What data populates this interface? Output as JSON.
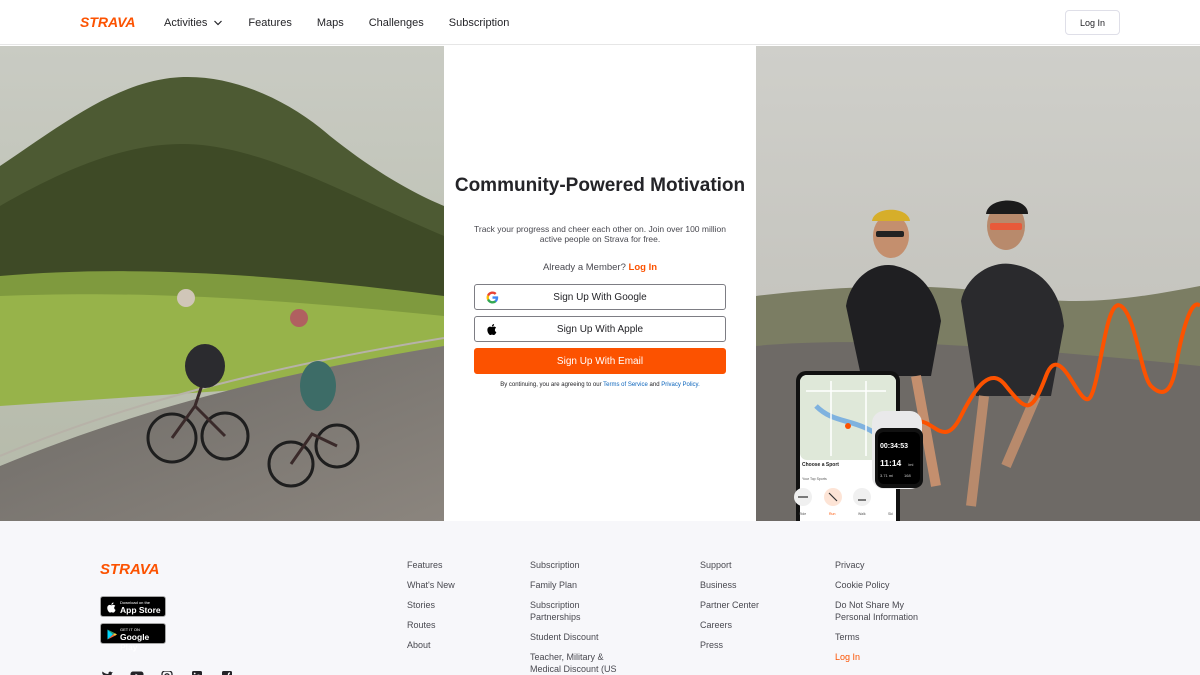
{
  "header": {
    "logo_text": "STRAVA",
    "nav": [
      {
        "label": "Activities",
        "has_dropdown": true
      },
      {
        "label": "Features"
      },
      {
        "label": "Maps"
      },
      {
        "label": "Challenges"
      },
      {
        "label": "Subscription"
      }
    ],
    "login_label": "Log In"
  },
  "hero": {
    "title": "Community-Powered Motivation",
    "subtitle": "Track your progress and cheer each other on. Join over 100 million active people on Strava for free.",
    "member_text": "Already a Member?",
    "member_link": "Log In",
    "google_button": "Sign Up With Google",
    "apple_button": "Sign Up With Apple",
    "email_button": "Sign Up With Email",
    "terms_prefix": "By continuing, you are agreeing to our",
    "terms_link": "Terms of Service",
    "terms_and": "and",
    "privacy_link": "Privacy Policy.",
    "phone": {
      "choose_sport": "Choose a Sport",
      "top_sports": "Your Top Sports",
      "sport_labels": [
        "Ride",
        "Run",
        "Walk",
        "Ski"
      ]
    },
    "watch": {
      "time1": "00:34:53",
      "time2": "11:14",
      "unit": "/mi",
      "stat1": "3.71 mi",
      "stat2": "168"
    }
  },
  "footer": {
    "logo_text": "STRAVA",
    "app_store": {
      "small": "Download on the",
      "big": "App Store"
    },
    "google_play": {
      "small": "GET IT ON",
      "big": "Google Play"
    },
    "col1": [
      "Features",
      "What's New",
      "Stories",
      "Routes",
      "About"
    ],
    "col2": [
      "Subscription",
      "Family Plan",
      "Subscription Partnerships",
      "Student Discount",
      "Teacher, Military & Medical Discount (US"
    ],
    "col3": [
      "Support",
      "Business",
      "Partner Center",
      "Careers",
      "Press"
    ],
    "col4": [
      "Privacy",
      "Cookie Policy",
      "Do Not Share My Personal Information",
      "Terms",
      "Log In"
    ],
    "social": [
      "twitter-icon",
      "youtube-icon",
      "instagram-icon",
      "linkedin-icon",
      "facebook-icon"
    ]
  },
  "colors": {
    "brand": "#fc5200",
    "text": "#242428",
    "link_blue": "#0a64bc",
    "footer_bg": "#f7f7fa"
  }
}
